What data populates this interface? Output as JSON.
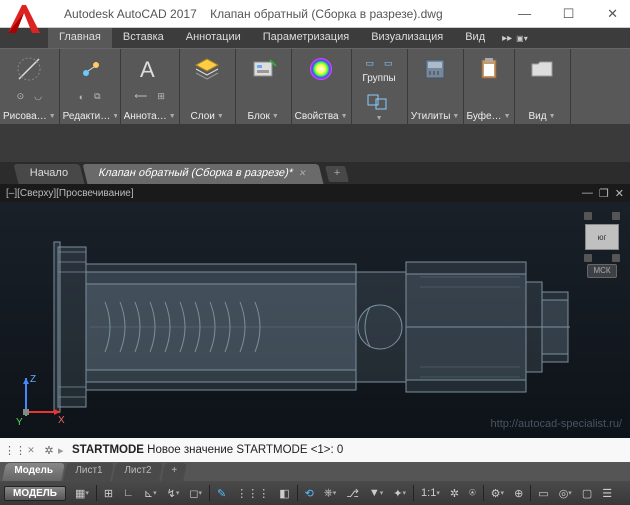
{
  "titlebar": {
    "app": "Autodesk AutoCAD 2017",
    "doc": "Клапан обратный (Сборка в разрезе).dwg"
  },
  "menu": {
    "tabs": [
      "Главная",
      "Вставка",
      "Аннотации",
      "Параметризация",
      "Визуализация",
      "Вид"
    ],
    "active": 0
  },
  "ribbon": {
    "panels": [
      {
        "label": "Рисова…"
      },
      {
        "label": "Редакти…"
      },
      {
        "label": "Аннота…"
      },
      {
        "label": "Слои"
      },
      {
        "label": "Блок"
      },
      {
        "label": "Свойства"
      },
      {
        "label": "Группы"
      },
      {
        "label": "Утилиты"
      },
      {
        "label": "Буфе…"
      },
      {
        "label": "Вид"
      }
    ]
  },
  "doctabs": {
    "tabs": [
      {
        "label": "Начало",
        "active": false
      },
      {
        "label": "Клапан обратный (Сборка в разрезе)*",
        "active": true
      }
    ]
  },
  "viewport": {
    "state": "[–][Сверху][Просвечивание]",
    "cube": "юг",
    "wcs": "МСК",
    "watermark": "http://autocad-specialist.ru/",
    "ucs": {
      "x": "X",
      "y": "Y",
      "z": "Z"
    }
  },
  "cmdline": {
    "text1": "STARTMODE",
    "text2": " Новое значение STARTMODE <1>:  0"
  },
  "layouttabs": [
    "Модель",
    "Лист1",
    "Лист2",
    "+"
  ],
  "statusbar": {
    "model": "МОДЕЛЬ",
    "scale": "1:1"
  }
}
